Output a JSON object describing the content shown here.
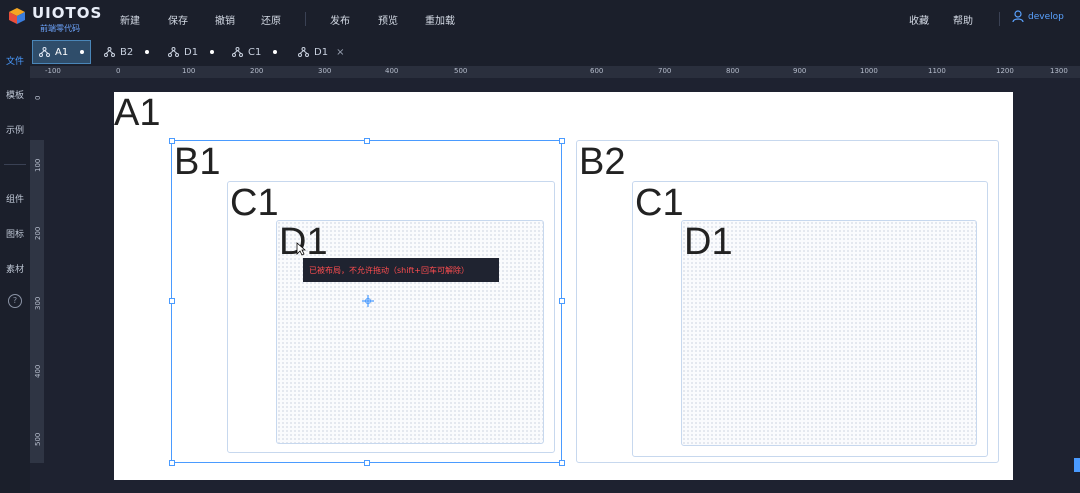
{
  "app": {
    "logo_text": "UIOTOS",
    "logo_sub": "前端零代码"
  },
  "menu": {
    "items": [
      {
        "label": "新建"
      },
      {
        "label": "保存"
      },
      {
        "label": "撤销"
      },
      {
        "label": "还原"
      },
      {
        "label": "发布"
      },
      {
        "label": "预览"
      },
      {
        "label": "重加载"
      }
    ],
    "right": [
      {
        "label": "收藏"
      },
      {
        "label": "帮助"
      }
    ],
    "user": "develop"
  },
  "tabs": [
    {
      "label": "A1",
      "active": true,
      "state": "dot"
    },
    {
      "label": "B2",
      "active": false,
      "state": "dot"
    },
    {
      "label": "D1",
      "active": false,
      "state": "dot"
    },
    {
      "label": "C1",
      "active": false,
      "state": "dot"
    },
    {
      "label": "D1",
      "active": false,
      "state": "close",
      "close_glyph": "×"
    }
  ],
  "leftnav": [
    {
      "label": "文件",
      "active": true
    },
    {
      "label": "模板",
      "active": false
    },
    {
      "label": "示例",
      "active": false
    },
    {
      "label": "组件",
      "active": false
    },
    {
      "label": "图标",
      "active": false
    },
    {
      "label": "素材",
      "active": false
    }
  ],
  "help_glyph": "?",
  "ruler": {
    "h": [
      "-100",
      "0",
      "100",
      "200",
      "300",
      "400",
      "500",
      "600",
      "700",
      "800",
      "900",
      "1000",
      "1100",
      "1200",
      "1300"
    ],
    "v": [
      "0",
      "100",
      "200",
      "300",
      "400",
      "500"
    ]
  },
  "canvas": {
    "labels": {
      "a1": "A1",
      "b1": "B1",
      "c1_left": "C1",
      "d1_left": "D1",
      "b2": "B2",
      "c1_right": "C1",
      "d1_right": "D1"
    },
    "tooltip": "已被布局，不允许拖动（shift+回车可解除）"
  },
  "colors": {
    "accent": "#4a9bff",
    "warning_text": "#ff4d4f",
    "background": "#1e2230"
  }
}
